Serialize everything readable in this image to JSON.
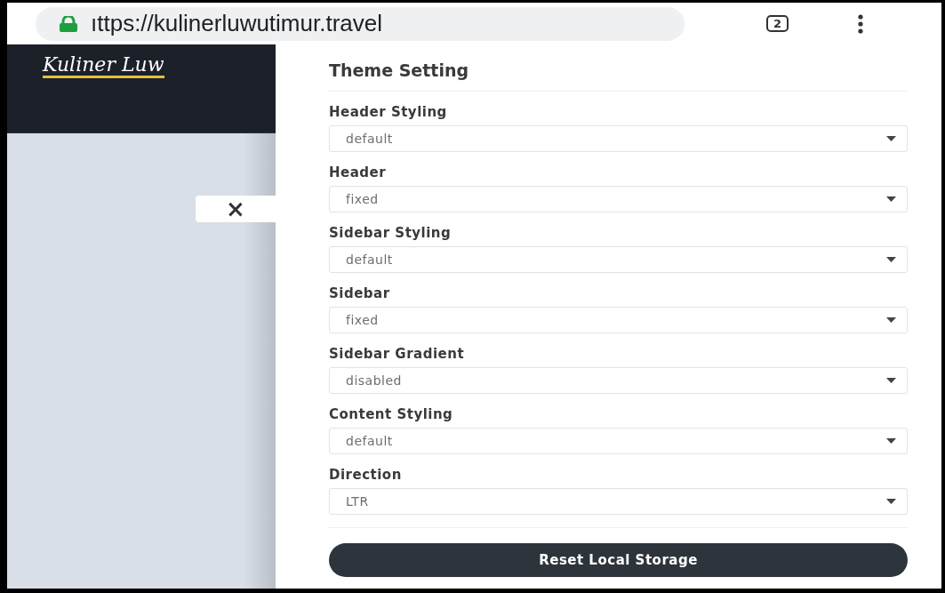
{
  "browser": {
    "url": "ıttps://kulinerluwutimur.travel",
    "tab_count": "2"
  },
  "site": {
    "logo": "Kuliner Luw"
  },
  "close_button": {
    "label": "×"
  },
  "panel": {
    "title": "Theme Setting",
    "settings": [
      {
        "label": "Header Styling",
        "value": "default"
      },
      {
        "label": "Header",
        "value": "fixed"
      },
      {
        "label": "Sidebar Styling",
        "value": "default"
      },
      {
        "label": "Sidebar",
        "value": "fixed"
      },
      {
        "label": "Sidebar Gradient",
        "value": "disabled"
      },
      {
        "label": "Content Styling",
        "value": "default"
      },
      {
        "label": "Direction",
        "value": "LTR"
      }
    ],
    "reset_button": "Reset Local Storage"
  }
}
